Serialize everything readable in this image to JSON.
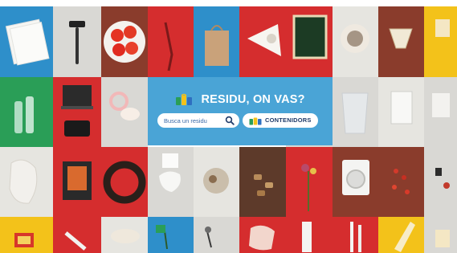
{
  "hero": {
    "title": "RESIDU, ON VAS?",
    "search_placeholder": "Busca un residu",
    "containers_label": "CONTENIDORS",
    "background_color": "#4aa4d6",
    "icons": {
      "title": "recycling-bins-icon",
      "search": "search-icon",
      "containers": "recycling-bins-icon"
    }
  },
  "grid": {
    "rows": [
      [
        "paper-sheets",
        "razor",
        "tomatoes-plate",
        "drinking-straw",
        "paper-bag",
        "pizza-box",
        "picture-frame",
        "ashtray-plate",
        "coffee-filter",
        "yellow-partial"
      ],
      [
        "glass-bottles",
        "laptop",
        "pacifier",
        "hero",
        "hero",
        "hero",
        "light-bulb",
        "plastic-bags",
        "empty-packaging",
        "grey-partial"
      ],
      [
        "crumpled-plastic",
        "photo-frame",
        "bike-tyre",
        "paper-tissue",
        "food-crumbs",
        "bottle-corks",
        "dried-flowers",
        "washing-machine",
        "red-berries",
        "small-objects"
      ],
      [
        "yellow-box",
        "white-pipe",
        "ceramic-bowl",
        "plant-stems",
        "hanging-clip",
        "crumpled-paper",
        "paper-roll",
        "pencil-sticks",
        "plastic-bottle",
        "yellow-partial"
      ]
    ],
    "colors": {
      "blue": "#2e8fca",
      "grey": "#d9d8d4",
      "brown": "#8a3c2c",
      "red": "#d52d2e",
      "dark_brown": "#5d3a2a",
      "green": "#2a9e57",
      "yellow": "#f3c21a",
      "light_grey": "#e6e5e0"
    }
  }
}
